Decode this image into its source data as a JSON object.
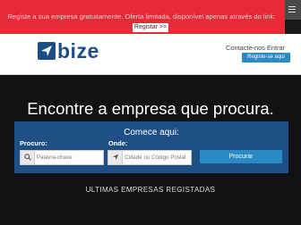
{
  "promo": {
    "text": "Registe a sua empresa gratuitamente. Oferta limitada, disponível apenas através do link:",
    "button_label": "Registar >>"
  },
  "brand": {
    "name": "bize",
    "color": "#1c4e86"
  },
  "nav": {
    "contact_label": "Contacte-nos",
    "enter_label": "Entrar",
    "cta_label": "Registe-se aqui"
  },
  "hero": {
    "headline": "Encontre a empresa que procura.",
    "panel_title": "Comece aqui:",
    "what_label": "Procuro:",
    "what_placeholder": "Palavra-chave",
    "where_label": "Onde:",
    "where_placeholder": "Cidade ou Código Postal",
    "search_label": "Procurar",
    "bottom_text": "ULTIMAS EMPRESAS REGISTADAS"
  },
  "colors": {
    "promo_bar": "#e52b37",
    "panel": "#1e4f85",
    "accent_button": "#2a8ac3"
  },
  "icons": [
    "hamburger-menu-icon",
    "logo-arrow-icon",
    "search-icon",
    "location-arrow-icon"
  ]
}
